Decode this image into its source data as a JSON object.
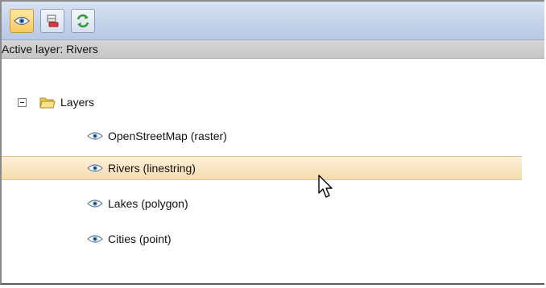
{
  "toolbar": {
    "buttons": [
      {
        "icon": "eye-icon",
        "active": true
      },
      {
        "icon": "remove-layer-icon",
        "active": false
      },
      {
        "icon": "refresh-icon",
        "active": false
      }
    ]
  },
  "active_layer_text": "Active layer: Rivers",
  "tree": {
    "root": {
      "label": "Layers",
      "expanded": true,
      "icon": "folder-icon"
    },
    "layers": [
      {
        "label": "OpenStreetMap (raster)",
        "icon": "eye-icon",
        "selected": false
      },
      {
        "label": "Rivers (linestring)",
        "icon": "eye-icon",
        "selected": true
      },
      {
        "label": "Lakes (polygon)",
        "icon": "eye-icon",
        "selected": false
      },
      {
        "label": "Cities (point)",
        "icon": "eye-icon",
        "selected": false
      }
    ]
  },
  "colors": {
    "selection": "#f6dcae",
    "toolbar": "#c4d3ea",
    "active_button": "#f7c85c"
  }
}
